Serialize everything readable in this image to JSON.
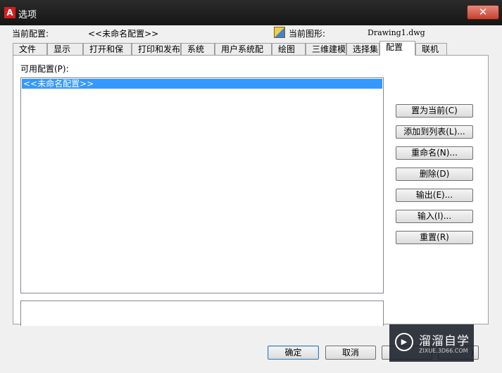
{
  "window": {
    "title": "选项",
    "close_symbol": "✕"
  },
  "header": {
    "profile_label": "当前配置:",
    "profile_value": "<<未命名配置>>",
    "drawing_label": "当前图形:",
    "drawing_value": "Drawing1.dwg"
  },
  "tabs": [
    {
      "label": "文件"
    },
    {
      "label": "显示"
    },
    {
      "label": "打开和保存"
    },
    {
      "label": "打印和发布"
    },
    {
      "label": "系统"
    },
    {
      "label": "用户系统配置"
    },
    {
      "label": "绘图"
    },
    {
      "label": "三维建模"
    },
    {
      "label": "选择集"
    },
    {
      "label": "配置",
      "active": true
    },
    {
      "label": "联机"
    }
  ],
  "panel": {
    "available_label": "可用配置(P):",
    "profiles": [
      "<<未命名配置>>"
    ],
    "buttons": [
      {
        "label": "置为当前(C)"
      },
      {
        "label": "添加到列表(L)..."
      },
      {
        "label": "重命名(N)..."
      },
      {
        "label": "删除(D)"
      },
      {
        "label": "输出(E)..."
      },
      {
        "label": "输入(I)..."
      },
      {
        "label": "重置(R)"
      }
    ]
  },
  "footer": {
    "ok_label": "确定",
    "cancel_label": "取消",
    "help_visible": ")"
  },
  "watermark": {
    "icon_glyph": "▶",
    "text": "溜溜自学",
    "url": "ZIXUE.3D66.COM"
  },
  "colors": {
    "selection": "#3399ff",
    "title_bar": "#1e1e1e",
    "close_button": "#c8402f"
  }
}
